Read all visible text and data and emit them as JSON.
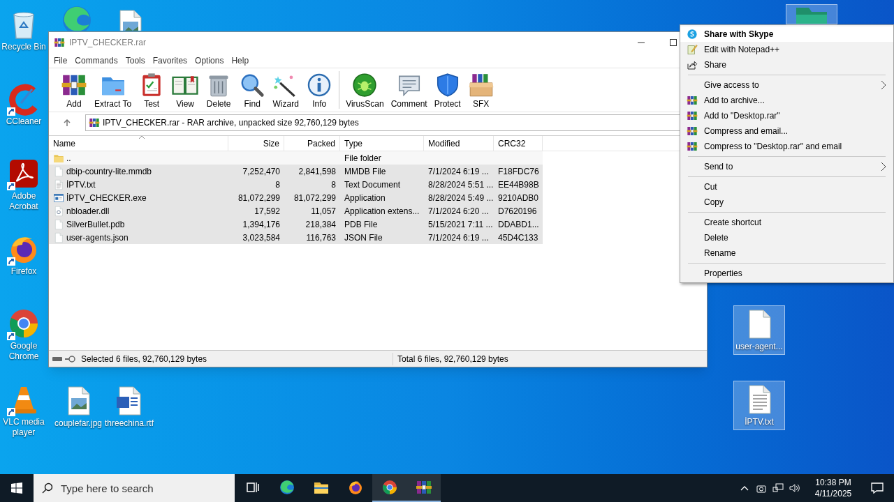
{
  "desktop_icons": [
    {
      "label": "Recycle Bin",
      "kind": "recycle",
      "shortcut": false,
      "selected": false
    },
    {
      "kind": "edge",
      "selected": false
    },
    {
      "kind": "image",
      "selected": false
    },
    {
      "label": "CCleaner",
      "kind": "ccleaner",
      "shortcut": true,
      "selected": false
    },
    {
      "label": "Adobe Acrobat",
      "kind": "acrobat",
      "shortcut": true,
      "selected": false
    },
    {
      "label": "Firefox",
      "kind": "firefox",
      "shortcut": true,
      "selected": false
    },
    {
      "label": "Google Chrome",
      "kind": "chrome",
      "shortcut": true,
      "selected": false
    },
    {
      "label": "VLC media player",
      "kind": "vlc",
      "shortcut": true,
      "selected": false
    },
    {
      "label": "couplefar.jpg",
      "kind": "image",
      "shortcut": false,
      "selected": false
    },
    {
      "label": "threechina.rtf",
      "kind": "word",
      "shortcut": false,
      "selected": false
    },
    {
      "kind": "folder",
      "selected": true
    },
    {
      "label": "user-agent...",
      "kind": "file",
      "shortcut": false,
      "selected": true
    },
    {
      "label": "İPTV.txt",
      "kind": "text",
      "shortcut": false,
      "selected": true
    }
  ],
  "window": {
    "title": "IPTV_CHECKER.rar",
    "menu": [
      "File",
      "Commands",
      "Tools",
      "Favorites",
      "Options",
      "Help"
    ],
    "toolbar": [
      {
        "buttons": [
          {
            "label": "Add",
            "kind": "add"
          },
          {
            "label": "Extract To",
            "kind": "extract"
          },
          {
            "label": "Test",
            "kind": "test"
          },
          {
            "label": "View",
            "kind": "view"
          },
          {
            "label": "Delete",
            "kind": "delete"
          },
          {
            "label": "Find",
            "kind": "find"
          },
          {
            "label": "Wizard",
            "kind": "wizard"
          },
          {
            "label": "Info",
            "kind": "info"
          }
        ]
      },
      {
        "buttons": [
          {
            "label": "VirusScan",
            "kind": "virus"
          },
          {
            "label": "Comment",
            "kind": "comment"
          },
          {
            "label": "Protect",
            "kind": "protect"
          },
          {
            "label": "SFX",
            "kind": "sfx"
          }
        ]
      }
    ],
    "address": "IPTV_CHECKER.rar - RAR archive, unpacked size 92,760,129 bytes",
    "table": {
      "columns": [
        {
          "label": "Name",
          "sorted": true
        },
        {
          "label": "Size",
          "sorted": false
        },
        {
          "label": "Packed",
          "sorted": false
        },
        {
          "label": "Type",
          "sorted": false
        },
        {
          "label": "Modified",
          "sorted": false
        },
        {
          "label": "CRC32",
          "sorted": false
        }
      ],
      "rows": [
        {
          "kind": "folder",
          "selected": false,
          "cells": [
            "..",
            "",
            "",
            "File folder",
            "",
            ""
          ]
        },
        {
          "kind": "file",
          "selected": true,
          "cells": [
            "dbip-country-lite.mmdb",
            "7,252,470",
            "2,841,598",
            "MMDB File",
            "7/1/2024 6:19 ...",
            "F18FDC76"
          ]
        },
        {
          "kind": "text",
          "selected": true,
          "cells": [
            "İPTV.txt",
            "8",
            "8",
            "Text Document",
            "8/28/2024 5:51 ...",
            "EE44B98B"
          ]
        },
        {
          "kind": "exe",
          "selected": true,
          "cells": [
            "İPTV_CHECKER.exe",
            "81,072,299",
            "81,072,299",
            "Application",
            "8/28/2024 5:49 ...",
            "9210ADB0"
          ]
        },
        {
          "kind": "dll",
          "selected": true,
          "cells": [
            "nbloader.dll",
            "17,592",
            "11,057",
            "Application extens...",
            "7/1/2024 6:20 ...",
            "D7620196"
          ]
        },
        {
          "kind": "file",
          "selected": true,
          "cells": [
            "SilverBullet.pdb",
            "1,394,176",
            "218,384",
            "PDB File",
            "5/15/2021 7:11 ...",
            "DDABD1..."
          ]
        },
        {
          "kind": "file",
          "selected": true,
          "cells": [
            "user-agents.json",
            "3,023,584",
            "116,763",
            "JSON File",
            "7/1/2024 6:19 ...",
            "45D4C133"
          ]
        }
      ]
    },
    "status_bar": [
      "Selected 6 files, 92,760,129 bytes",
      "Total 6 files, 92,760,129 bytes"
    ]
  },
  "context_menu": [
    {
      "items": [
        {
          "label": "Share with Skype",
          "kind": "skype",
          "default": true,
          "selected": true,
          "submenu": false
        },
        {
          "label": "Edit with Notepad++",
          "kind": "notepad",
          "default": false,
          "selected": false,
          "submenu": false
        },
        {
          "label": "Share",
          "kind": "share",
          "default": false,
          "selected": false,
          "submenu": false
        }
      ]
    },
    {
      "items": [
        {
          "label": "Give access to",
          "default": false,
          "selected": false,
          "submenu": true
        },
        {
          "label": "Add to archive...",
          "kind": "winrar",
          "default": false,
          "selected": false,
          "submenu": false
        },
        {
          "label": "Add to \"Desktop.rar\"",
          "kind": "winrar",
          "default": false,
          "selected": false,
          "submenu": false
        },
        {
          "label": "Compress and email...",
          "kind": "winrar",
          "default": false,
          "selected": false,
          "submenu": false
        },
        {
          "label": "Compress to \"Desktop.rar\" and email",
          "kind": "winrar",
          "default": false,
          "selected": false,
          "submenu": false
        }
      ]
    },
    {
      "items": [
        {
          "label": "Send to",
          "default": false,
          "selected": false,
          "submenu": true
        }
      ]
    },
    {
      "items": [
        {
          "label": "Cut",
          "default": false,
          "selected": false,
          "submenu": false
        },
        {
          "label": "Copy",
          "default": false,
          "selected": false,
          "submenu": false
        }
      ]
    },
    {
      "items": [
        {
          "label": "Create shortcut",
          "default": false,
          "selected": false,
          "submenu": false
        },
        {
          "label": "Delete",
          "default": false,
          "selected": false,
          "submenu": false
        },
        {
          "label": "Rename",
          "default": false,
          "selected": false,
          "submenu": false
        }
      ]
    },
    {
      "items": [
        {
          "label": "Properties",
          "default": false,
          "selected": false,
          "submenu": false
        }
      ]
    }
  ],
  "taskbar": {
    "search": {
      "placeholder": "Type here to search"
    },
    "apps": [
      {
        "kind": "taskview",
        "active": false
      },
      {
        "kind": "edge",
        "active": false
      },
      {
        "kind": "explorer",
        "active": false
      },
      {
        "kind": "firefox",
        "active": false
      },
      {
        "kind": "chrome",
        "active": true
      },
      {
        "kind": "winrar",
        "active": true
      }
    ],
    "time": "10:38 PM",
    "date": "4/11/2025"
  }
}
